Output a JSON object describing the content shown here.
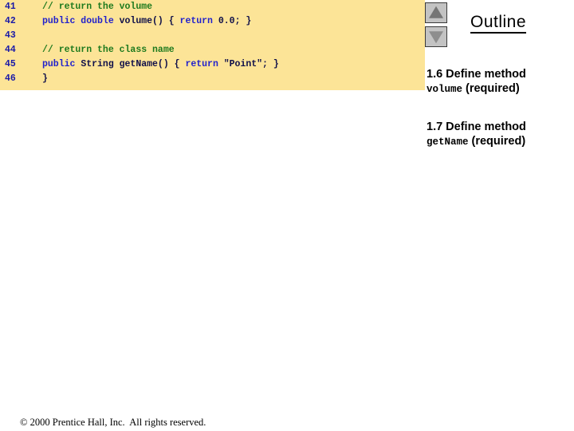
{
  "code_panel": {
    "background_color": "#fce497",
    "lines": [
      {
        "number": "41",
        "tokens": [
          {
            "text": "// return the volume",
            "type": "comment"
          }
        ]
      },
      {
        "number": "42",
        "tokens": [
          {
            "text": "public double ",
            "type": "keyword"
          },
          {
            "text": "volume() { ",
            "type": "plain"
          },
          {
            "text": "return ",
            "type": "keyword"
          },
          {
            "text": "0.0; }",
            "type": "plain"
          }
        ]
      },
      {
        "number": "43",
        "tokens": []
      },
      {
        "number": "44",
        "tokens": [
          {
            "text": "// return the class name",
            "type": "comment"
          }
        ]
      },
      {
        "number": "45",
        "tokens": [
          {
            "text": "public ",
            "type": "keyword"
          },
          {
            "text": "String getName() { ",
            "type": "plain"
          },
          {
            "text": "return ",
            "type": "keyword"
          },
          {
            "text": "\"Point\"; }",
            "type": "plain"
          }
        ]
      },
      {
        "number": "46",
        "tokens": [
          {
            "text": "}",
            "type": "plain"
          }
        ]
      }
    ]
  },
  "scroll": {
    "up_icon": "triangle-up-icon",
    "down_icon": "triangle-down-icon",
    "button_color": "#c3c3c3",
    "triangle_color": "#757575"
  },
  "outline": {
    "title": "Outline",
    "entries": [
      {
        "heading": "1.6 Define method",
        "code": "volume",
        "note": "(required)"
      },
      {
        "heading": "1.7 Define method",
        "code": "getName",
        "note": "(required)"
      }
    ]
  },
  "footer": {
    "text": "© 2000 Prentice Hall, Inc.  All rights reserved."
  }
}
